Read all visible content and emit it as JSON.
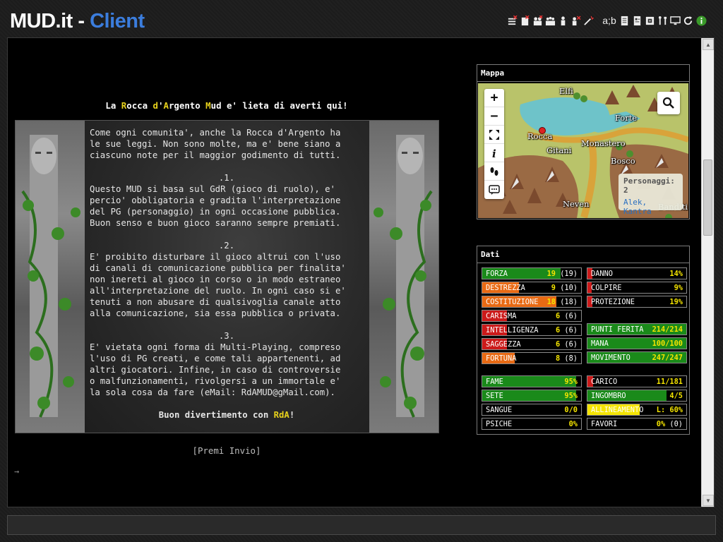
{
  "header": {
    "brand_main": "MUD.it",
    "brand_sep": " - ",
    "brand_accent": "Client",
    "accent_color": "#3b7ddd",
    "toolbar_icons": [
      "list-remove-icon",
      "notes-remove-icon",
      "people-remove-icon",
      "people-group-icon",
      "person-icon",
      "person-remove-icon",
      "wand-icon",
      "font-size-icon",
      "document-icon",
      "document-list-icon",
      "export-icon",
      "tools-icon",
      "monitor-icon",
      "refresh-icon",
      "info-icon"
    ],
    "font_toggle_label": "a;b"
  },
  "output": {
    "welcome": {
      "p1": "La ",
      "w1": "R",
      "p2": "occa ",
      "w2": "d",
      "p3": "'",
      "w3": "A",
      "p4": "rgento ",
      "w4": "M",
      "p5": "ud e' lieta di averti qui!"
    },
    "intro": "Come ogni comunita', anche la Rocca d'Argento ha\nle sue leggi. Non sono molte, ma e' bene siano a\nciascuno note per il maggior godimento di tutti.",
    "rule1_num": ".1.",
    "rule1": "Questo MUD si basa sul GdR (gioco di ruolo), e'\npercio' obbligatoria e gradita l'interpretazione\ndel PG (personaggio) in ogni occasione pubblica.\nBuon senso e buon gioco saranno sempre premiati.",
    "rule2_num": ".2.",
    "rule2": "E' proibito disturbare il gioco altrui con l'uso\ndi canali di comunicazione pubblica per finalita'\nnon inereti al gioco in corso o in modo estraneo\nall'interpretazione del ruolo. In ogni caso si e'\ntenuti a non abusare di qualsivoglia canale atto\nalla comunicazione, sia essa pubblica o privata.",
    "rule3_num": ".3.",
    "rule3": "E' vietata ogni forma di Multi-Playing, compreso\nl'uso di PG creati, e come tali appartenenti, ad\naltri giocatori. Infine, in caso di controversie\no malfunzionamenti, rivolgersi a un immortale e'\nla sola cosa da fare (eMail: RdAMUD@gMail.com).",
    "goodbye_pre": "Buon divertimento con ",
    "goodbye_name": "RdA",
    "goodbye_post": "!",
    "premi": "[Premi Invio]",
    "prompt": "→"
  },
  "map": {
    "title": "Mappa",
    "zoom_in": "+",
    "zoom_out": "−",
    "places": [
      "Elfi",
      "Rocca",
      "Gitani",
      "Monastero",
      "Forte",
      "Bosco",
      "Neven",
      "Banditi"
    ],
    "popup_title": "Personaggi: 2",
    "popup_names": "Alek, Kantra",
    "colors": {
      "grass": "#b9c36a",
      "water": "#6ec3c9",
      "road": "#d9a33a",
      "mountain": "#8b5a3c"
    }
  },
  "data": {
    "title": "Dati",
    "stats": [
      {
        "label": "FORZA",
        "value": "19",
        "extra": "(19)",
        "fill": 0.79,
        "color": "#1a8a1a"
      },
      {
        "label": "DESTREZZA",
        "value": "9",
        "extra": "(10)",
        "fill": 0.37,
        "color": "#e86a14"
      },
      {
        "label": "COSTITUZIONE",
        "value": "18",
        "extra": "(18)",
        "fill": 0.75,
        "color": "#e86a14"
      },
      {
        "label": "CARISMA",
        "value": "6",
        "extra": "(6)",
        "fill": 0.25,
        "color": "#cc1a1a"
      },
      {
        "label": "INTELLIGENZA",
        "value": "6",
        "extra": "(6)",
        "fill": 0.25,
        "color": "#cc1a1a"
      },
      {
        "label": "SAGGEZZA",
        "value": "6",
        "extra": "(6)",
        "fill": 0.25,
        "color": "#cc1a1a"
      },
      {
        "label": "FORTUNA",
        "value": "8",
        "extra": "(8)",
        "fill": 0.33,
        "color": "#e86a14"
      }
    ],
    "combat": [
      {
        "label": "DANNO",
        "value": "14%",
        "fill": 0.05,
        "color": "#cc1a1a"
      },
      {
        "label": "COLPIRE",
        "value": "9%",
        "fill": 0.04,
        "color": "#cc1a1a"
      },
      {
        "label": "PROTEZIONE",
        "value": "19%",
        "fill": 0.05,
        "color": "#cc1a1a"
      }
    ],
    "vitals": [
      {
        "label": "PUNTI FERITA",
        "value": "214/214",
        "fill": 1.0,
        "color": "#1a8a1a"
      },
      {
        "label": "MANA",
        "value": "100/100",
        "fill": 1.0,
        "color": "#1a8a1a"
      },
      {
        "label": "MOVIMENTO",
        "value": "247/247",
        "fill": 1.0,
        "color": "#1a8a1a"
      }
    ],
    "needs": [
      {
        "label": "FAME",
        "value": "95%",
        "fill": 0.95,
        "color": "#1a8a1a"
      },
      {
        "label": "SETE",
        "value": "95%",
        "fill": 0.95,
        "color": "#1a8a1a"
      },
      {
        "label": "SANGUE",
        "value": "0/0",
        "fill": 0.0,
        "color": "#1a8a1a"
      },
      {
        "label": "PSICHE",
        "value": "0%",
        "fill": 0.0,
        "color": "#1a8a1a"
      }
    ],
    "other": [
      {
        "label": "CARICO",
        "value": "11/181",
        "fill": 0.06,
        "color": "#cc1a1a"
      },
      {
        "label": "INGOMBRO",
        "value": "4/5",
        "fill": 0.8,
        "color": "#1a8a1a"
      },
      {
        "label": "ALLINEAMENTO",
        "value": "L: 60%",
        "fill": 0.53,
        "color": "#f4e400"
      },
      {
        "label": "FAVORI",
        "value": "0%",
        "extra": "(0)",
        "fill": 0.0,
        "color": "#1a8a1a"
      }
    ]
  }
}
